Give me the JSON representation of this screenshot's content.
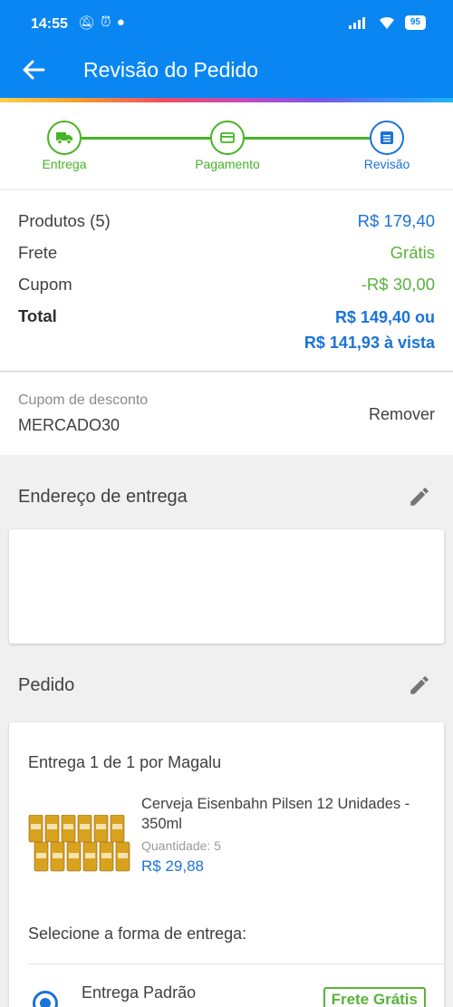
{
  "status_bar": {
    "time": "14:55",
    "battery": "95"
  },
  "app_bar": {
    "title": "Revisão do Pedido"
  },
  "stepper": {
    "steps": [
      {
        "label": "Entrega",
        "icon": "truck-icon"
      },
      {
        "label": "Pagamento",
        "icon": "card-icon"
      },
      {
        "label": "Revisão",
        "icon": "list-icon"
      }
    ],
    "colors": {
      "done": "#46b523",
      "active": "#1a73d8"
    }
  },
  "summary": {
    "products_label": "Produtos (5)",
    "products_value": "R$ 179,40",
    "shipping_label": "Frete",
    "shipping_value": "Grátis",
    "coupon_label": "Cupom",
    "coupon_value": "-R$ 30,00",
    "total_label": "Total",
    "total_value_line1": "R$ 149,40 ou",
    "total_value_line2": "R$ 141,93 à vista"
  },
  "coupon": {
    "label": "Cupom de desconto",
    "code": "MERCADO30",
    "remove_label": "Remover"
  },
  "address": {
    "title": "Endereço de entrega"
  },
  "order": {
    "title": "Pedido",
    "delivery_by": "Entrega 1 de 1 por Magalu",
    "product": {
      "name": "Cerveja Eisenbahn Pilsen 12 Unidades - 350ml",
      "quantity_label": "Quantidade:",
      "quantity": "5",
      "price": "R$ 29,88"
    },
    "shipping_prompt": "Selecione a forma de entrega:",
    "shipping_option": "Entrega Padrão",
    "shipping_badge": "Frete Grátis"
  },
  "colors": {
    "primary": "#0a86f3",
    "accent_blue": "#1a73d8",
    "accent_green": "#58b33b"
  }
}
